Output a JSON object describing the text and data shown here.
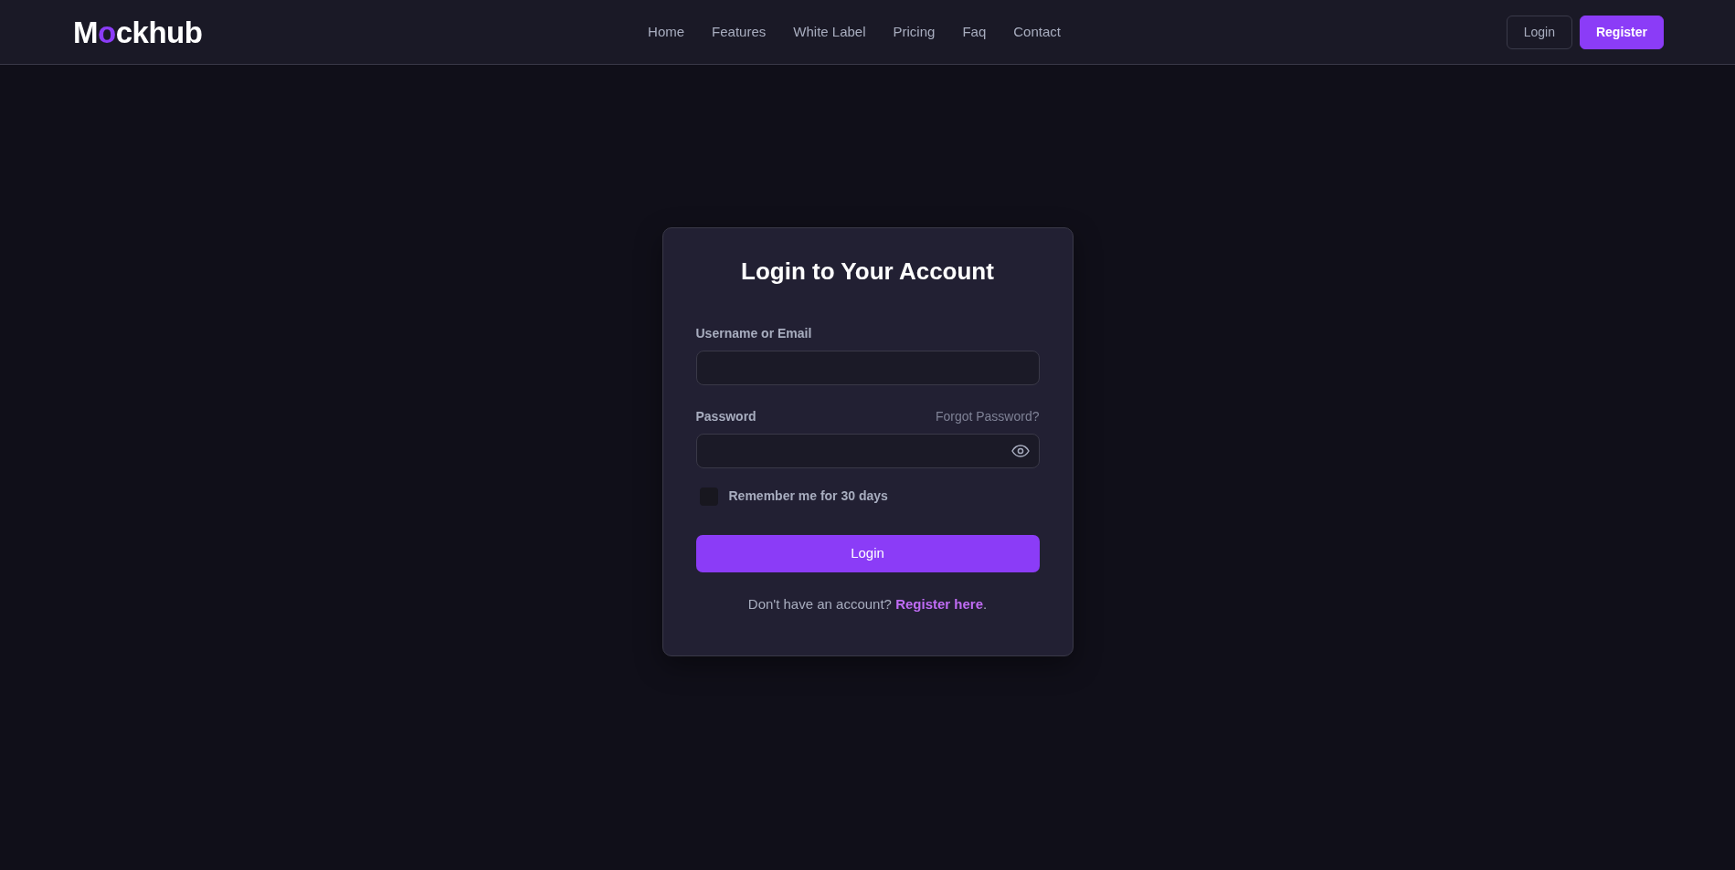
{
  "header": {
    "logo": {
      "parts": [
        {
          "text": "M",
          "accent": false
        },
        {
          "text": "o",
          "accent": true
        },
        {
          "text": "ckhub",
          "accent": false
        }
      ]
    },
    "nav": [
      {
        "label": "Home"
      },
      {
        "label": "Features"
      },
      {
        "label": "White Label"
      },
      {
        "label": "Pricing"
      },
      {
        "label": "Faq"
      },
      {
        "label": "Contact"
      }
    ],
    "buttons": [
      {
        "label": "Login",
        "kind": "outline"
      },
      {
        "label": "Register",
        "kind": "primary"
      }
    ]
  },
  "login_card": {
    "title": "Login to Your Account",
    "username": {
      "label": "Username or Email"
    },
    "password": {
      "label": "Password",
      "forgot_link": "Forgot Password?"
    },
    "remember": {
      "label": "Remember me for 30 days",
      "checked": false
    },
    "submit": "Login",
    "footer": {
      "prompt": "Don't have an account?",
      "link": "Register here",
      "suffix": "."
    }
  }
}
